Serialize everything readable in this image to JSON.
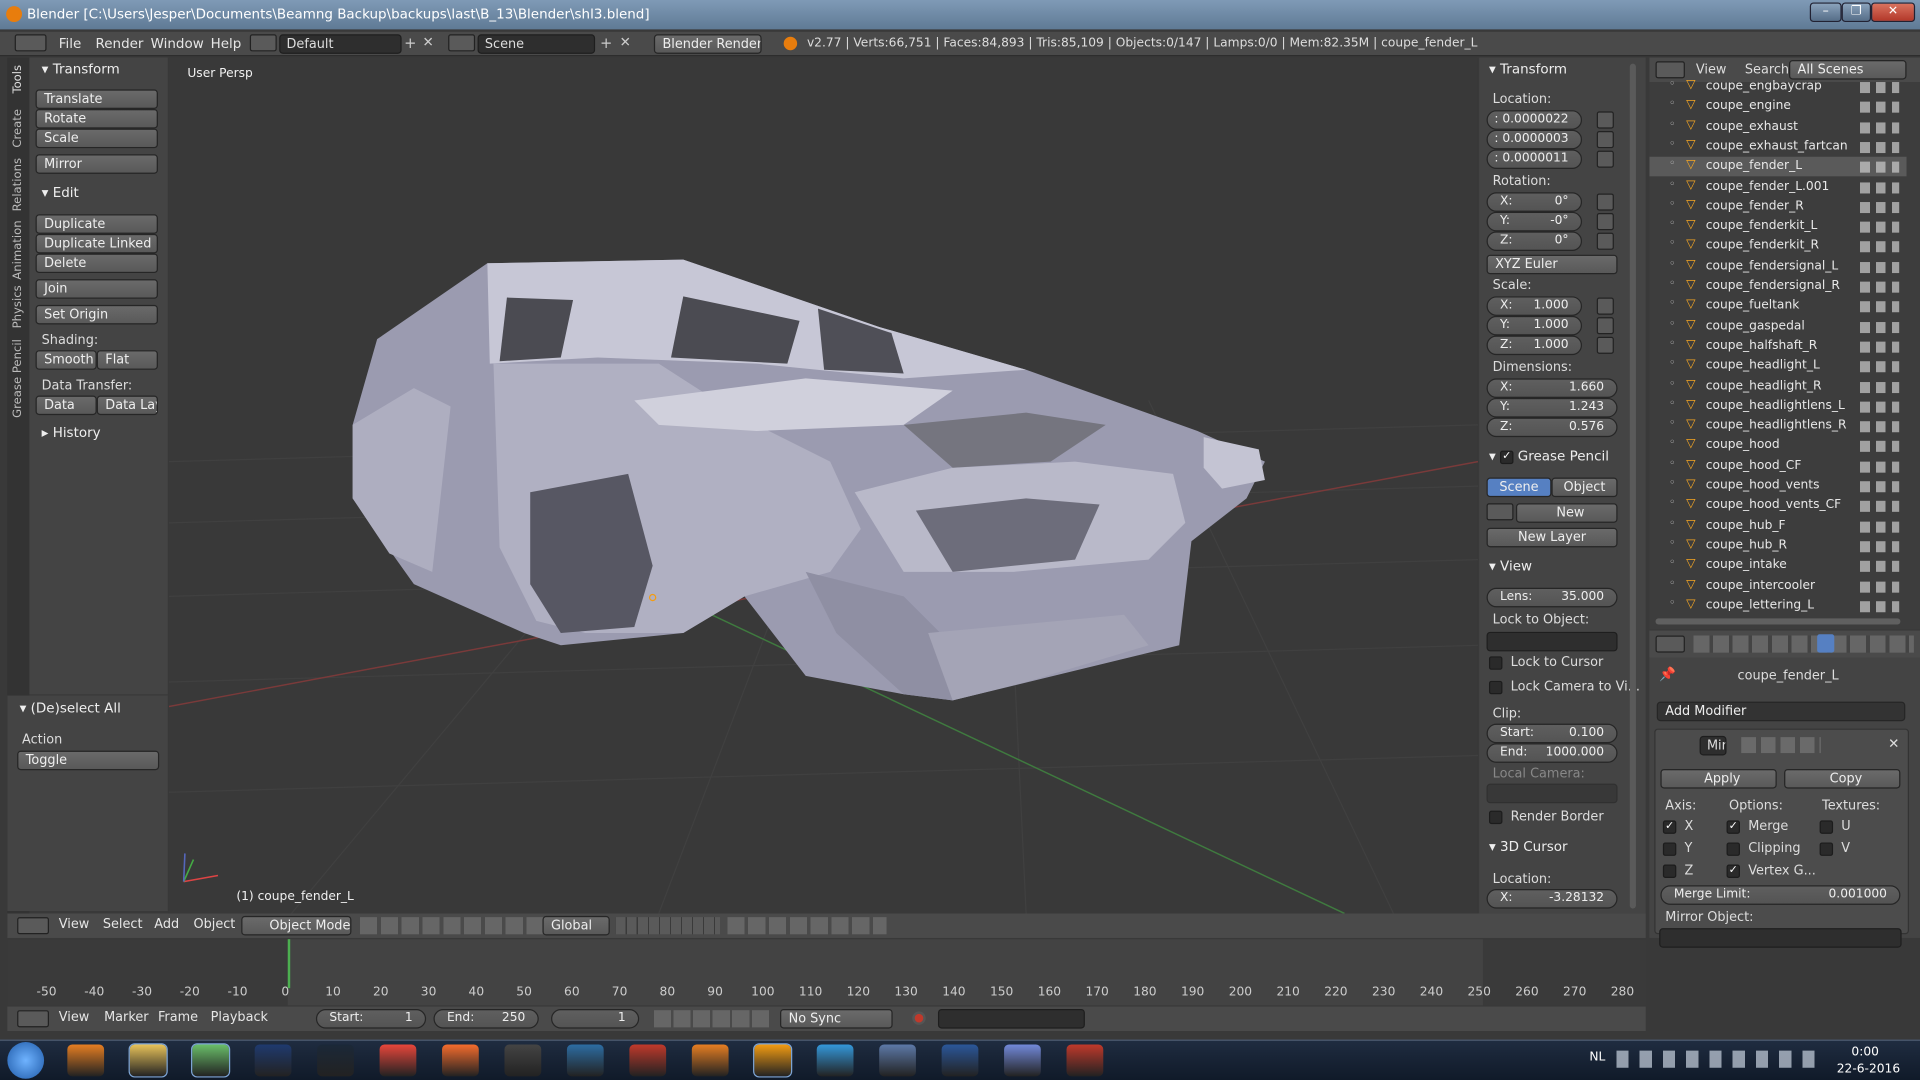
{
  "window": {
    "title": "Blender [C:\\Users\\Jesper\\Documents\\Beamng Backup\\backups\\last\\B_13\\Blender\\shl3.blend]",
    "controls": [
      "–",
      "❐",
      "✕"
    ]
  },
  "header": {
    "menus": [
      "File",
      "Render",
      "Window",
      "Help"
    ],
    "layout": "Default",
    "scene": "Scene",
    "engine": "Blender Render",
    "stats": "v2.77 | Verts:66,751 | Faces:84,893 | Tris:85,109 | Objects:0/147 | Lamps:0/0 | Mem:82.35M | coupe_fender_L"
  },
  "toolshelf": {
    "tabs": [
      "Tools",
      "Create",
      "Relations",
      "Animation",
      "Physics",
      "Grease Pencil"
    ],
    "transform_title": "Transform",
    "translate": "Translate",
    "rotate": "Rotate",
    "scale": "Scale",
    "mirror": "Mirror",
    "edit_title": "Edit",
    "duplicate": "Duplicate",
    "duplicate_linked": "Duplicate Linked",
    "delete": "Delete",
    "join": "Join",
    "set_origin": "Set Origin",
    "shading_label": "Shading:",
    "smooth": "Smooth",
    "flat": "Flat",
    "data_transfer_label": "Data Transfer:",
    "data": "Data",
    "data_layo": "Data Layo",
    "history": "History"
  },
  "operator": {
    "title": "(De)select All",
    "action_label": "Action",
    "action_value": "Toggle"
  },
  "viewport": {
    "label": "User Persp",
    "object_label": "(1) coupe_fender_L"
  },
  "properties": {
    "transform_title": "Transform",
    "location_label": "Location:",
    "location": [
      ": 0.0000022",
      ": 0.0000003",
      ": 0.0000011"
    ],
    "rotation_label": "Rotation:",
    "rotation": [
      {
        "axis": "X:",
        "value": "0°"
      },
      {
        "axis": "Y:",
        "value": "-0°"
      },
      {
        "axis": "Z:",
        "value": "0°"
      }
    ],
    "rotation_mode": "XYZ Euler",
    "scale_label": "Scale:",
    "scale": [
      {
        "axis": "X:",
        "value": "1.000"
      },
      {
        "axis": "Y:",
        "value": "1.000"
      },
      {
        "axis": "Z:",
        "value": "1.000"
      }
    ],
    "dimensions_label": "Dimensions:",
    "dimensions": [
      {
        "axis": "X:",
        "value": "1.660"
      },
      {
        "axis": "Y:",
        "value": "1.243"
      },
      {
        "axis": "Z:",
        "value": "0.576"
      }
    ],
    "grease_pencil_title": "Grease Pencil",
    "gp_scene": "Scene",
    "gp_object": "Object",
    "gp_new": "New",
    "gp_new_layer": "New Layer",
    "view_title": "View",
    "lens_label": "Lens:",
    "lens_value": "35.000",
    "lock_to_object": "Lock to Object:",
    "lock_to_cursor": "Lock to Cursor",
    "lock_camera": "Lock Camera to Vi...",
    "clip_label": "Clip:",
    "clip_start_label": "Start:",
    "clip_start": "0.100",
    "clip_end_label": "End:",
    "clip_end": "1000.000",
    "local_camera": "Local Camera:",
    "render_border": "Render Border",
    "cursor_title": "3D Cursor",
    "cursor_location": "Location:",
    "cursor_x_label": "X:",
    "cursor_x": "-3.28132"
  },
  "outliner": {
    "menus": [
      "View",
      "Search"
    ],
    "filter": "All Scenes",
    "items": [
      "coupe_engbaycrap",
      "coupe_engine",
      "coupe_exhaust",
      "coupe_exhaust_fartcan",
      "coupe_fender_L",
      "coupe_fender_L.001",
      "coupe_fender_R",
      "coupe_fenderkit_L",
      "coupe_fenderkit_R",
      "coupe_fendersignal_L",
      "coupe_fendersignal_R",
      "coupe_fueltank",
      "coupe_gaspedal",
      "coupe_halfshaft_R",
      "coupe_headlight_L",
      "coupe_headlight_R",
      "coupe_headlightlens_L",
      "coupe_headlightlens_R",
      "coupe_hood",
      "coupe_hood_CF",
      "coupe_hood_vents",
      "coupe_hood_vents_CF",
      "coupe_hub_F",
      "coupe_hub_R",
      "coupe_intake",
      "coupe_intercooler",
      "coupe_lettering_L"
    ]
  },
  "modifier": {
    "object": "coupe_fender_L",
    "add_modifier": "Add Modifier",
    "name": "Mirr",
    "apply": "Apply",
    "copy": "Copy",
    "axis_label": "Axis:",
    "options_label": "Options:",
    "textures_label": "Textures:",
    "axes": [
      "X",
      "Y",
      "Z"
    ],
    "options": [
      "Merge",
      "Clipping",
      "Vertex G..."
    ],
    "textures": [
      "U",
      "V"
    ],
    "merge_limit_label": "Merge Limit:",
    "merge_limit": "0.001000",
    "mirror_object": "Mirror Object:"
  },
  "viewport_header": {
    "menus": [
      "View",
      "Select",
      "Add",
      "Object"
    ],
    "mode": "Object Mode",
    "orientation": "Global"
  },
  "timeline": {
    "ticks": [
      "-50",
      "-40",
      "-30",
      "-20",
      "-10",
      "0",
      "10",
      "20",
      "30",
      "40",
      "50",
      "60",
      "70",
      "80",
      "90",
      "100",
      "110",
      "120",
      "130",
      "140",
      "150",
      "160",
      "170",
      "180",
      "190",
      "200",
      "210",
      "220",
      "230",
      "240",
      "250",
      "260",
      "270",
      "280"
    ],
    "menus": [
      "View",
      "Marker",
      "Frame",
      "Playback"
    ],
    "start_label": "Start:",
    "start": "1",
    "end_label": "End:",
    "end": "250",
    "current": "1",
    "sync": "No Sync"
  },
  "taskbar": {
    "lang": "NL",
    "time": "0:00",
    "date": "22-6-2016",
    "apps": [
      "start",
      "media",
      "explorer",
      "notepad",
      "photoshop",
      "steam",
      "chrome",
      "origin",
      "unity",
      "ue4",
      "acrobat",
      "substance",
      "blender",
      "eye",
      "paint",
      "word",
      "discord",
      "solidworks"
    ]
  }
}
